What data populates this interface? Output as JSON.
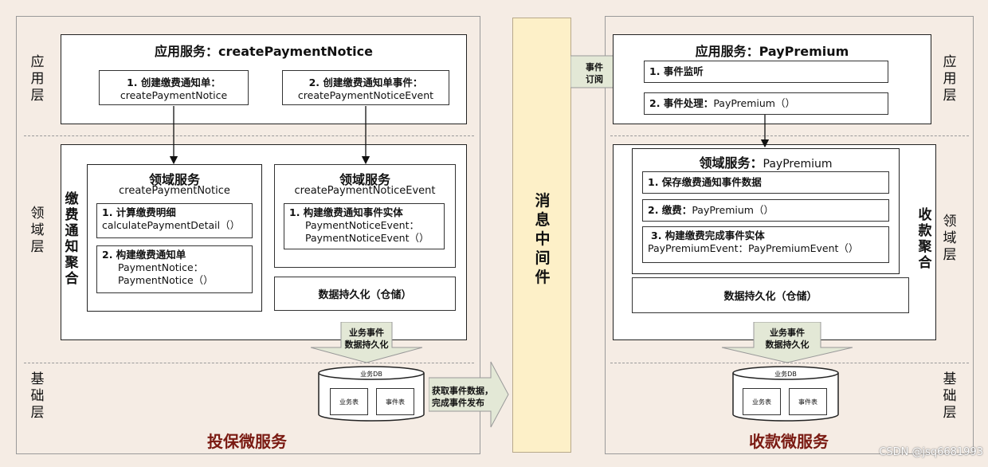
{
  "left_panel": {
    "layer_app": "应用层",
    "layer_domain": "领域层",
    "layer_infra": "基础层",
    "app_service_title": "应用服务：createPaymentNotice",
    "app_step1_line1": "1. 创建缴费通知单：",
    "app_step1_line2": "createPaymentNotice",
    "app_step2_line1": "2. 创建缴费通知单事件：",
    "app_step2_line2": "createPaymentNoticeEvent",
    "aggregate_label": "缴费通知聚合",
    "domain1_title": "领域服务",
    "domain1_sub": "createPaymentNotice",
    "domain1_item1_line1": "1. 计算缴费明细",
    "domain1_item1_line2": "calculatePaymentDetail（）",
    "domain1_item2_line1": "2. 构建缴费通知单",
    "domain1_item2_line2": "PaymentNotice：",
    "domain1_item2_line3": "PaymentNotice（）",
    "domain2_title": "领域服务",
    "domain2_sub": "createPaymentNoticeEvent",
    "domain2_item1_line1": "1. 构建缴费通知事件实体",
    "domain2_item1_line2": "PaymentNoticeEvent：",
    "domain2_item1_line3": "PaymentNoticeEvent（）",
    "persist": "数据持久化（仓储）",
    "arrow_line1": "业务事件",
    "arrow_line2": "数据持久化",
    "db_title": "业务DB",
    "db_table1": "业务表",
    "db_table2": "事件表",
    "right_arrow_line1": "获取事件数据，",
    "right_arrow_line2": "完成事件发布",
    "service_name": "投保微服务"
  },
  "middleware": {
    "label": "消息中间件"
  },
  "right_panel": {
    "subscribe_line1": "事件",
    "subscribe_line2": "订阅",
    "layer_app": "应用层",
    "layer_domain": "领域层",
    "layer_infra": "基础层",
    "app_service_title": "应用服务：PayPremium",
    "app_step1": "1. 事件监听",
    "app_step2_bold": "2. 事件处理：",
    "app_step2_rest": "PayPremium（）",
    "aggregate_label": "收款聚合",
    "domain_title_bold": "领域服务：",
    "domain_title_rest": "PayPremium",
    "domain_item1": "1. 保存缴费通知事件数据",
    "domain_item2_bold": "2. 缴费：",
    "domain_item2_rest": "PayPremium（）",
    "domain_item3_line1": "3. 构建缴费完成事件实体",
    "domain_item3_line2": "PayPremiumEvent：PayPremiumEvent（）",
    "persist": "数据持久化（仓储）",
    "arrow_line1": "业务事件",
    "arrow_line2": "数据持久化",
    "db_title": "业务DB",
    "db_table1": "业务表",
    "db_table2": "事件表",
    "service_name": "收款微服务"
  },
  "watermark": "CSDN @jsq6681993",
  "colors": {
    "background": "#f5ece4",
    "middleware": "#fdf0c8",
    "arrow_fill": "#e3e8d6",
    "service_name": "#7a1a12"
  }
}
